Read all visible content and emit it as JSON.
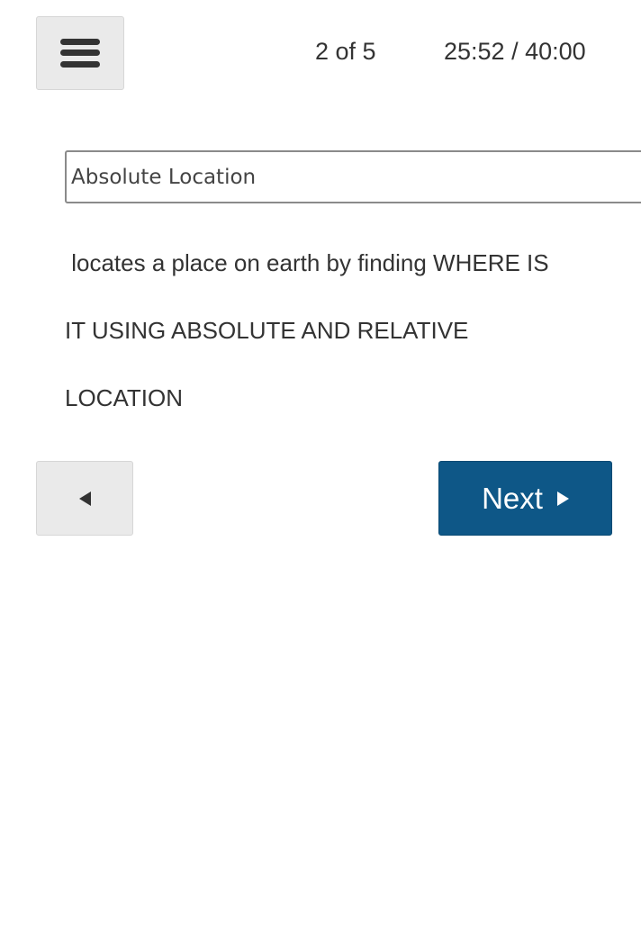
{
  "header": {
    "menu_icon": "hamburger-menu-icon",
    "progress": "2 of 5",
    "timer": "25:52 / 40:00"
  },
  "question": {
    "answer_value": "Absolute Location",
    "text_lines": [
      " locates a place on earth by finding WHERE IS",
      "IT USING ABSOLUTE AND RELATIVE",
      "LOCATION"
    ]
  },
  "navigation": {
    "prev_icon": "triangle-left-icon",
    "next_label": "Next",
    "next_icon": "triangle-right-icon"
  },
  "colors": {
    "next_button": "#0e5787",
    "secondary_button": "#eaeaea"
  }
}
